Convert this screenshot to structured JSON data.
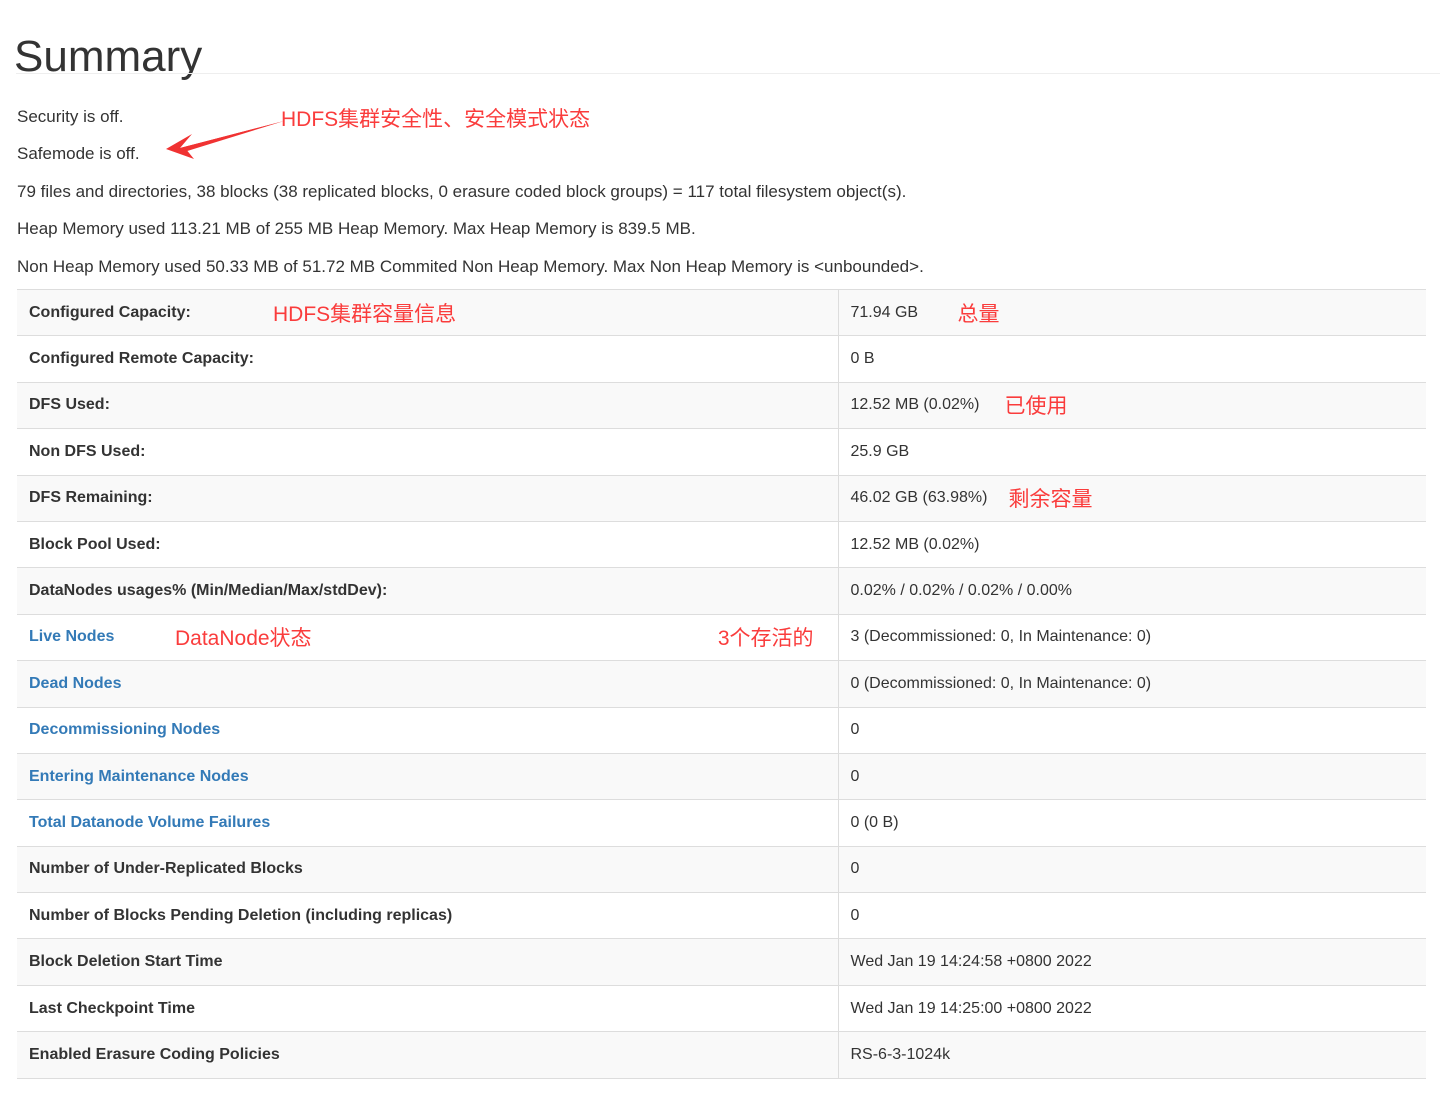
{
  "page": {
    "title": "Summary"
  },
  "status": {
    "security": "Security is off.",
    "safemode": "Safemode is off."
  },
  "fs_info": {
    "objects": "79 files and directories, 38 blocks (38 replicated blocks, 0 erasure coded block groups) = 117 total filesystem object(s).",
    "heap": "Heap Memory used 113.21 MB of 255 MB Heap Memory. Max Heap Memory is 839.5 MB.",
    "non_heap": "Non Heap Memory used 50.33 MB of 51.72 MB Commited Non Heap Memory. Max Non Heap Memory is <unbounded>."
  },
  "annotations": {
    "security_note": "HDFS集群安全性、安全模式状态",
    "capacity_note": "HDFS集群容量信息",
    "total_note": "总量",
    "used_note": "已使用",
    "remaining_note": "剩余容量",
    "datanode_note": "DataNode状态",
    "alive_note": "3个存活的",
    "color": "#fa3c3c"
  },
  "colors": {
    "link": "#337ab7",
    "text": "#333333",
    "row_stripe": "#f9f9f9",
    "border": "#dddddd"
  },
  "table": {
    "rows": [
      {
        "label": "Configured Capacity:",
        "value": "71.94 GB",
        "link": false
      },
      {
        "label": "Configured Remote Capacity:",
        "value": "0 B",
        "link": false
      },
      {
        "label": "DFS Used:",
        "value": "12.52 MB (0.02%)",
        "link": false
      },
      {
        "label": "Non DFS Used:",
        "value": "25.9 GB",
        "link": false
      },
      {
        "label": "DFS Remaining:",
        "value": "46.02 GB (63.98%)",
        "link": false
      },
      {
        "label": "Block Pool Used:",
        "value": "12.52 MB (0.02%)",
        "link": false
      },
      {
        "label": "DataNodes usages% (Min/Median/Max/stdDev):",
        "value": "0.02% / 0.02% / 0.02% / 0.00%",
        "link": false
      },
      {
        "label": "Live Nodes",
        "value": "3 (Decommissioned: 0, In Maintenance: 0)",
        "link": true
      },
      {
        "label": "Dead Nodes",
        "value": "0 (Decommissioned: 0, In Maintenance: 0)",
        "link": true
      },
      {
        "label": "Decommissioning Nodes",
        "value": "0",
        "link": true
      },
      {
        "label": "Entering Maintenance Nodes",
        "value": "0",
        "link": true
      },
      {
        "label": "Total Datanode Volume Failures",
        "value": "0 (0 B)",
        "link": true
      },
      {
        "label": "Number of Under-Replicated Blocks",
        "value": "0",
        "link": false
      },
      {
        "label": "Number of Blocks Pending Deletion (including replicas)",
        "value": "0",
        "link": false
      },
      {
        "label": "Block Deletion Start Time",
        "value": "Wed Jan 19 14:24:58 +0800 2022",
        "link": false
      },
      {
        "label": "Last Checkpoint Time",
        "value": "Wed Jan 19 14:25:00 +0800 2022",
        "link": false
      },
      {
        "label": "Enabled Erasure Coding Policies",
        "value": "RS-6-3-1024k",
        "link": false
      }
    ]
  }
}
